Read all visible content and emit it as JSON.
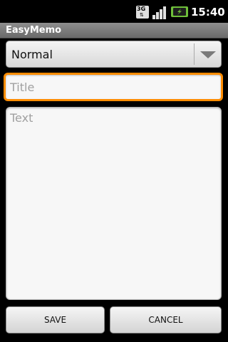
{
  "status_bar": {
    "network_badge": "3G",
    "time": "15:40",
    "icons": [
      "network-3g-icon",
      "signal-icon",
      "battery-charging-icon"
    ]
  },
  "app": {
    "title": "EasyMemo"
  },
  "form": {
    "priority_spinner": {
      "selected": "Normal"
    },
    "title_field": {
      "placeholder": "Title",
      "value": ""
    },
    "text_field": {
      "placeholder": "Text",
      "value": ""
    }
  },
  "buttons": {
    "save_label": "SAVE",
    "cancel_label": "CANCEL"
  },
  "colors": {
    "focus_accent": "#ff8c00",
    "title_bar": "#7a7a7a",
    "background": "#000000"
  }
}
